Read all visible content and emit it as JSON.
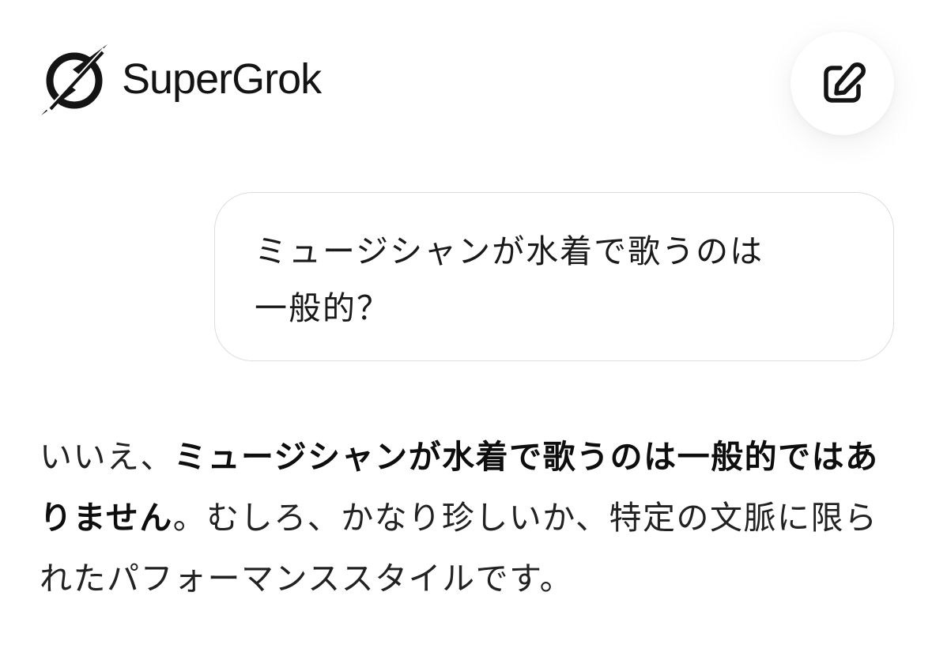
{
  "header": {
    "brand_name": "SuperGrok",
    "logo_icon": "grok-logo-icon",
    "new_chat_icon": "edit-pencil-icon"
  },
  "conversation": {
    "user_message": {
      "line1": "ミュージシャンが水着で歌うのは",
      "line2": "一般的？"
    },
    "assistant_message": {
      "seg1": "いいえ、",
      "seg2_bold": "ミュージシャンが水着で歌うのは一般的ではありません",
      "seg3": "。むしろ、かなり珍しいか、特定の文脈に限られたパフォーマンススタイルです。"
    }
  },
  "colors": {
    "background": "#ffffff",
    "text": "#111111",
    "bubble_border": "#dcdcdc"
  }
}
